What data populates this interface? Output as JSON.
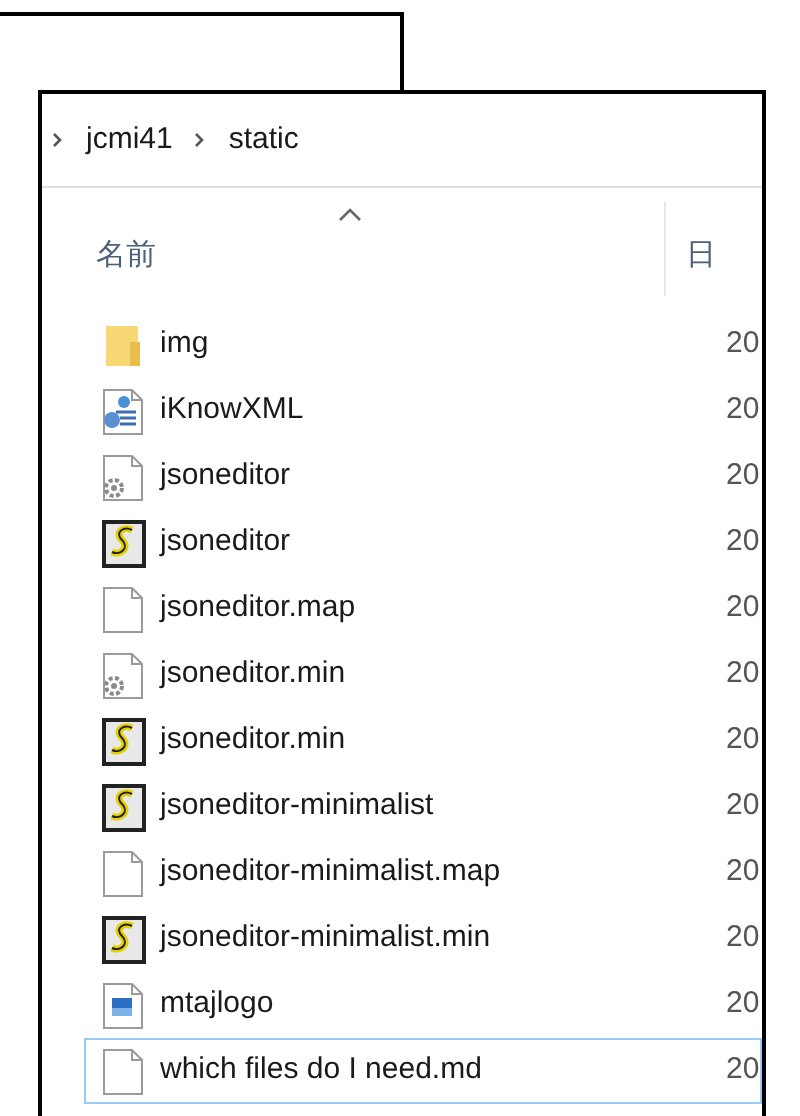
{
  "breadcrumb": [
    "jcmi41",
    "static"
  ],
  "columns": [
    {
      "label": "名前",
      "sorted": true
    },
    {
      "label": "日",
      "sorted": false
    }
  ],
  "rows": [
    {
      "kind": "folder",
      "name": "img",
      "date": "20",
      "focused": false
    },
    {
      "kind": "xml",
      "name": "iKnowXML",
      "date": "20",
      "focused": false
    },
    {
      "kind": "gear",
      "name": "jsoneditor",
      "date": "20",
      "focused": false
    },
    {
      "kind": "script",
      "name": "jsoneditor",
      "date": "20",
      "focused": false
    },
    {
      "kind": "blank",
      "name": "jsoneditor.map",
      "date": "20",
      "focused": false
    },
    {
      "kind": "gear",
      "name": "jsoneditor.min",
      "date": "20",
      "focused": false
    },
    {
      "kind": "script",
      "name": "jsoneditor.min",
      "date": "20",
      "focused": false
    },
    {
      "kind": "script",
      "name": "jsoneditor-minimalist",
      "date": "20",
      "focused": false
    },
    {
      "kind": "blank",
      "name": "jsoneditor-minimalist.map",
      "date": "20",
      "focused": false
    },
    {
      "kind": "script",
      "name": "jsoneditor-minimalist.min",
      "date": "20",
      "focused": false
    },
    {
      "kind": "image",
      "name": "mtajlogo",
      "date": "20",
      "focused": false
    },
    {
      "kind": "blank",
      "name": "which files do I need.md",
      "date": "20",
      "focused": true
    }
  ]
}
